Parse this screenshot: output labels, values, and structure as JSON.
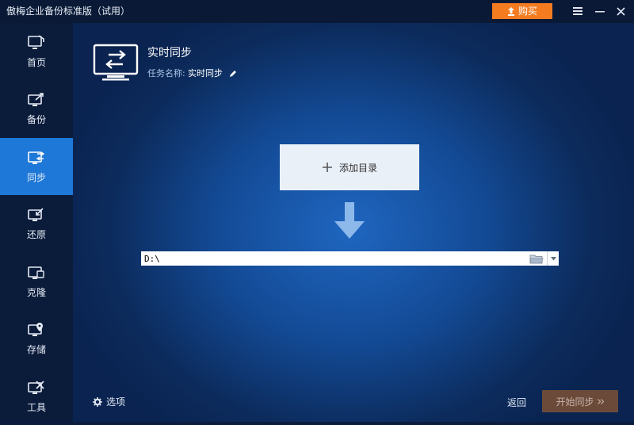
{
  "titlebar": {
    "title": "傲梅企业备份标准版（试用）",
    "buy_label": "购买"
  },
  "sidebar": {
    "items": [
      {
        "label": "首页",
        "icon": "home-icon"
      },
      {
        "label": "备份",
        "icon": "backup-icon"
      },
      {
        "label": "同步",
        "icon": "sync-icon",
        "active": true
      },
      {
        "label": "还原",
        "icon": "restore-icon"
      },
      {
        "label": "克隆",
        "icon": "clone-icon"
      },
      {
        "label": "存储",
        "icon": "storage-icon"
      },
      {
        "label": "工具",
        "icon": "tools-icon"
      }
    ]
  },
  "header": {
    "title": "实时同步",
    "task_label": "任务名称:",
    "task_name": "实时同步"
  },
  "main": {
    "add_dir_label": "添加目录",
    "destination_path": "D:\\"
  },
  "footer": {
    "options_label": "选项",
    "back_label": "返回",
    "start_label": "开始同步"
  },
  "colors": {
    "accent": "#1e78d8",
    "buy": "#f47b20",
    "start_disabled": "#6b4a3a"
  }
}
